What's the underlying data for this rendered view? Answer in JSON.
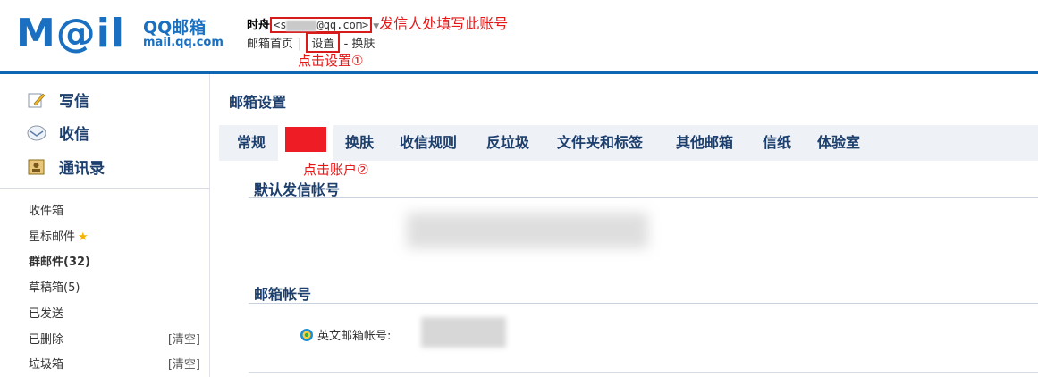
{
  "header": {
    "logo_text": "M@il",
    "brand": "QQ邮箱",
    "domain": "mail.qq.com",
    "nickname": "时舟",
    "email_prefix": "<s",
    "email_suffix": "@qq.com>",
    "annotation_sender": "发信人处填写此账号",
    "nav": {
      "home": "邮箱首页",
      "settings": "设置",
      "dash": "-",
      "skin": "换肤"
    },
    "annotation_settings": "点击设置①"
  },
  "sidebar": {
    "primary": [
      {
        "label": "写信",
        "icon": "compose-icon"
      },
      {
        "label": "收信",
        "icon": "inbox-receive-icon"
      },
      {
        "label": "通讯录",
        "icon": "contacts-icon"
      }
    ],
    "folders": [
      {
        "label": "收件箱"
      },
      {
        "label": "星标邮件",
        "icon": "star-icon"
      },
      {
        "label": "群邮件(32)",
        "bold": true
      },
      {
        "label": "草稿箱(5)"
      },
      {
        "label": "已发送"
      },
      {
        "label": "已删除",
        "action": "[清空]"
      },
      {
        "label": "垃圾箱",
        "action": "[清空]"
      }
    ]
  },
  "main": {
    "title": "邮箱设置",
    "tabs": [
      "常规",
      "换肤",
      "收信规则",
      "反垃圾",
      "文件夹和标签",
      "其他邮箱",
      "信纸",
      "体验室"
    ],
    "annotation_account": "点击账户②",
    "sections": {
      "default_sender": "默认发信帐号",
      "mail_account": "邮箱帐号"
    },
    "english_account_label": "英文邮箱帐号:"
  },
  "colors": {
    "brand_blue": "#1a6fc0",
    "annotation_red": "#e61717",
    "title_navy": "#1c3f6e",
    "tab_bar": "#eef1f5"
  }
}
